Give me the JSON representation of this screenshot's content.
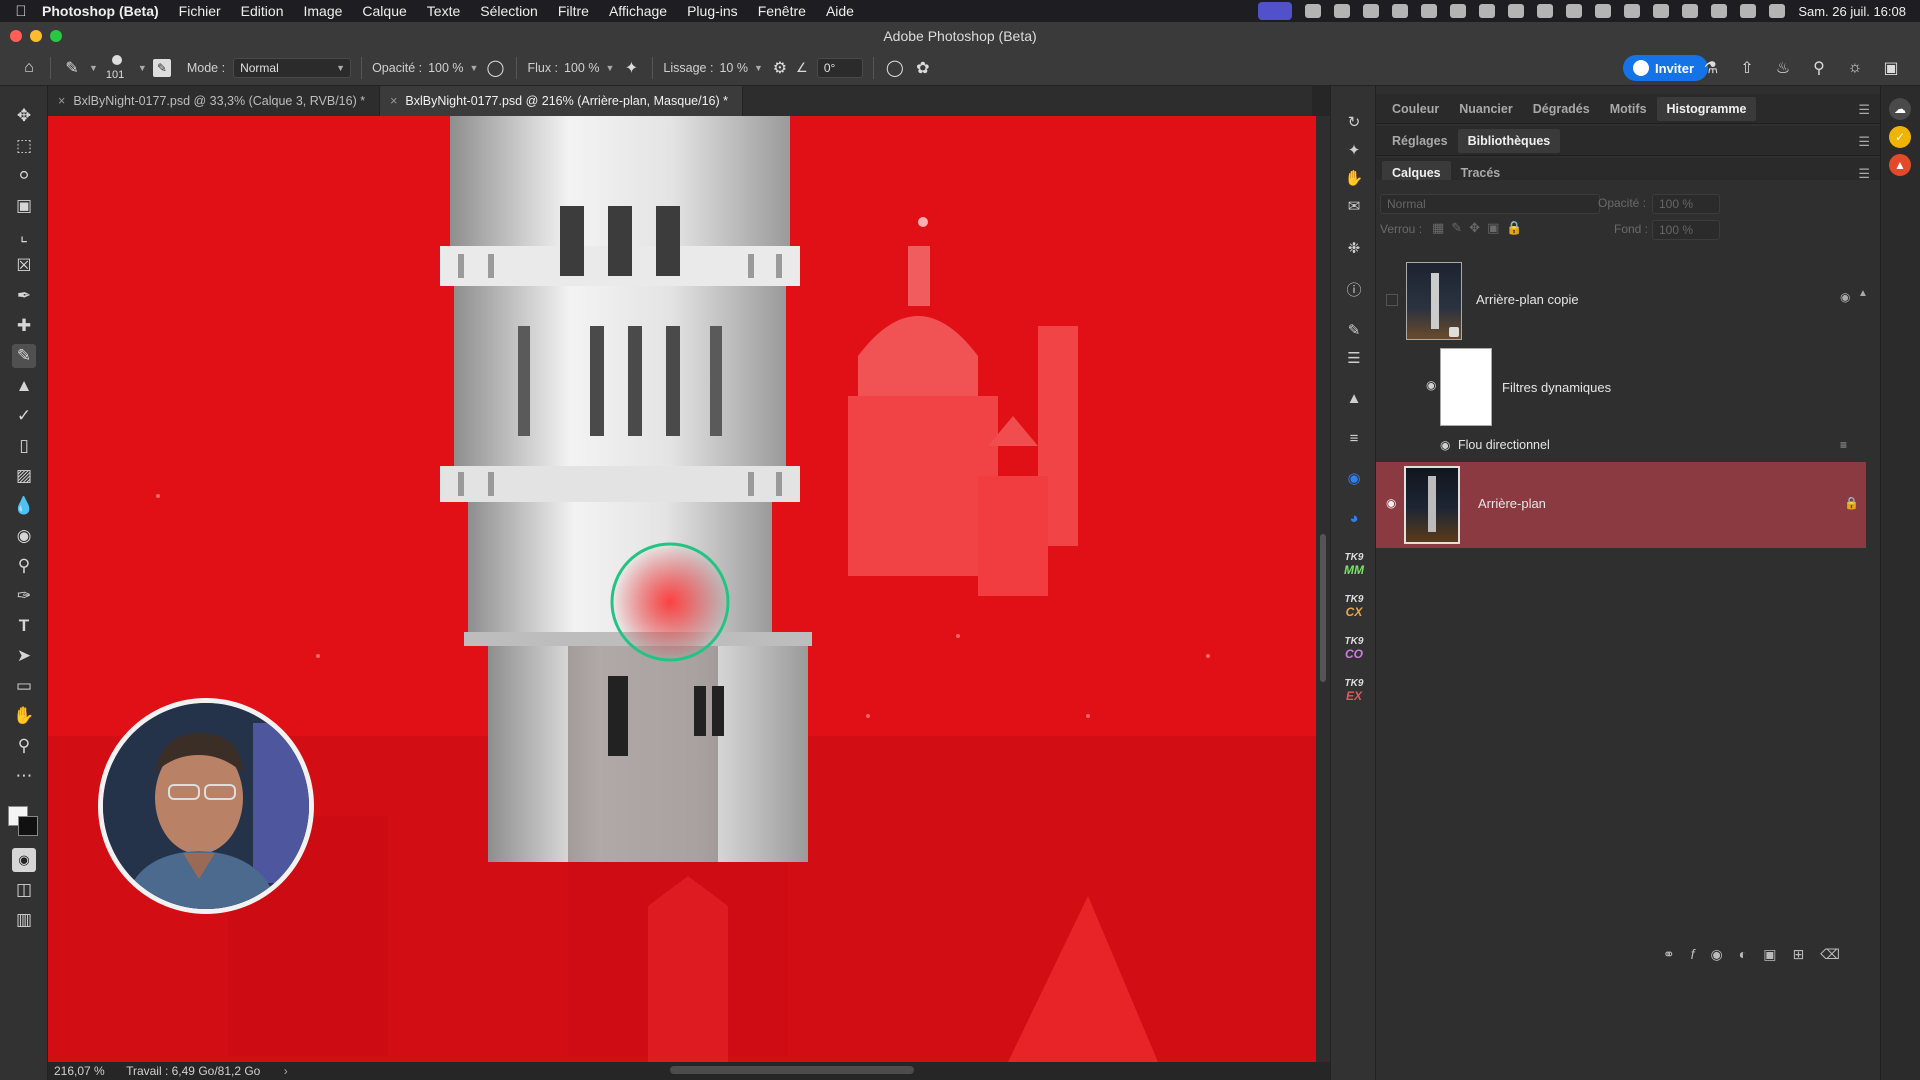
{
  "menubar": {
    "app_name": "Photoshop (Beta)",
    "items": [
      "Fichier",
      "Edition",
      "Image",
      "Calque",
      "Texte",
      "Sélection",
      "Filtre",
      "Affichage",
      "Plug-ins",
      "Fenêtre",
      "Aide"
    ],
    "datetime": "Sam. 26 juil. 16:08"
  },
  "window": {
    "title": "Adobe Photoshop (Beta)"
  },
  "options": {
    "brush_size": "101",
    "mode_label": "Mode :",
    "mode_value": "Normal",
    "opacity_label": "Opacité :",
    "opacity_value": "100 %",
    "flow_label": "Flux :",
    "flow_value": "100 %",
    "smoothing_label": "Lissage :",
    "smoothing_value": "10 %",
    "angle_value": "0°",
    "invite_label": "Inviter"
  },
  "tabs": [
    {
      "label": "BxlByNight-0177.psd @ 33,3% (Calque 3, RVB/16) *",
      "active": false
    },
    {
      "label": "BxlByNight-0177.psd @ 216% (Arrière-plan, Masque/16) *",
      "active": true
    }
  ],
  "status": {
    "zoom": "216,07 %",
    "doc_info": "Travail : 6,49 Go/81,2 Go"
  },
  "panels": {
    "row1": [
      "Couleur",
      "Nuancier",
      "Dégradés",
      "Motifs",
      "Histogramme"
    ],
    "row2": [
      "Réglages",
      "Bibliothèques"
    ],
    "row3": [
      "Calques",
      "Tracés"
    ]
  },
  "layers": {
    "blend_mode": "Normal",
    "opacity_label": "Opacité :",
    "opacity_value": "100 %",
    "lock_label": "Verrou :",
    "fill_label": "Fond :",
    "fill_value": "100 %",
    "items": [
      {
        "name": "Arrière-plan copie"
      },
      {
        "name": "Filtres dynamiques"
      },
      {
        "name": "Flou directionnel"
      },
      {
        "name": "Arrière-plan",
        "selected": true
      }
    ]
  },
  "plugins": [
    "MM",
    "CX",
    "CO",
    "EX"
  ],
  "plugin_prefix": "TK9",
  "colors": {
    "accent": "#1473e6",
    "mask_overlay": "#e11016",
    "selected_layer": "#8a3a40",
    "brush_cursor": "#23c383"
  }
}
